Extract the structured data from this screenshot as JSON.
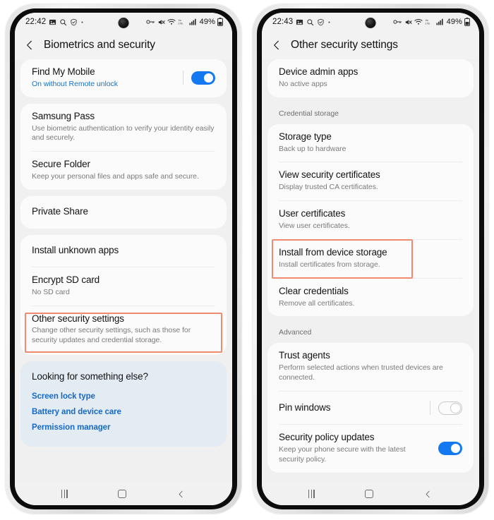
{
  "theme": {
    "accent_blue": "#1479f0",
    "link_blue": "#1769c4",
    "highlight_orange": "#f08a70",
    "card_bg": "#fbfbfb",
    "page_bg": "#f0f0f0",
    "promo_bg": "#e3ebf3"
  },
  "phones": [
    {
      "id": "left",
      "status_bar": {
        "clock": "22:42",
        "left_icons": [
          "image-icon",
          "search-icon",
          "shield-icon",
          "dot-icon"
        ],
        "right_icons": [
          "vpn-key-icon",
          "mute-icon",
          "wifi-icon",
          "volte-icon",
          "signal-icon"
        ],
        "battery_percent": "49%",
        "battery_icon": "battery-icon"
      },
      "header": {
        "back_icon": "back-chevron-icon",
        "title": "Biometrics and security"
      },
      "cards": [
        {
          "type": "list",
          "rows": [
            {
              "title": "Find My Mobile",
              "sub": "On without Remote unlock",
              "sub_style": "link",
              "toggle": "on"
            }
          ]
        },
        {
          "type": "list",
          "rows": [
            {
              "title": "Samsung Pass",
              "sub": "Use biometric authentication to verify your identity easily and securely."
            },
            {
              "title": "Secure Folder",
              "sub": "Keep your personal files and apps safe and secure."
            }
          ]
        },
        {
          "type": "list",
          "rows": [
            {
              "title": "Private Share",
              "sub": ""
            }
          ]
        },
        {
          "type": "list",
          "rows": [
            {
              "title": "Install unknown apps",
              "sub": ""
            },
            {
              "title": "Encrypt SD card",
              "sub": "No SD card"
            },
            {
              "title": "Other security settings",
              "sub": "Change other security settings, such as those for security updates and credential storage.",
              "highlighted": true
            }
          ]
        }
      ],
      "promo": {
        "title": "Looking for something else?",
        "links": [
          "Screen lock type",
          "Battery and device care",
          "Permission manager"
        ]
      },
      "nav": {
        "recents_label": "recents-button",
        "home_label": "home-button",
        "back_label": "back-button"
      }
    },
    {
      "id": "right",
      "status_bar": {
        "clock": "22:43",
        "left_icons": [
          "image-icon",
          "search-icon",
          "shield-icon",
          "dot-icon"
        ],
        "right_icons": [
          "vpn-key-icon",
          "mute-icon",
          "wifi-icon",
          "volte-icon",
          "signal-icon"
        ],
        "battery_percent": "49%",
        "battery_icon": "battery-icon"
      },
      "header": {
        "back_icon": "back-chevron-icon",
        "title": "Other security settings"
      },
      "cards": [
        {
          "type": "list",
          "rows": [
            {
              "title": "Device admin apps",
              "sub": "No active apps"
            }
          ]
        },
        {
          "type": "section",
          "label": "Credential storage"
        },
        {
          "type": "list",
          "rows": [
            {
              "title": "Storage type",
              "sub": "Back up to hardware"
            },
            {
              "title": "View security certificates",
              "sub": "Display trusted CA certificates."
            },
            {
              "title": "User certificates",
              "sub": "View user certificates."
            },
            {
              "title": "Install from device storage",
              "sub": "Install certificates from storage.",
              "highlighted": true
            },
            {
              "title": "Clear credentials",
              "sub": "Remove all certificates."
            }
          ]
        },
        {
          "type": "section",
          "label": "Advanced"
        },
        {
          "type": "list",
          "rows": [
            {
              "title": "Trust agents",
              "sub": "Perform selected actions when trusted devices are connected."
            },
            {
              "title": "Pin windows",
              "sub": "",
              "toggle": "off"
            },
            {
              "title": "Security policy updates",
              "sub": "Keep your phone secure with the latest security policy.",
              "toggle": "on"
            }
          ]
        }
      ],
      "nav": {
        "recents_label": "recents-button",
        "home_label": "home-button",
        "back_label": "back-button"
      }
    }
  ]
}
